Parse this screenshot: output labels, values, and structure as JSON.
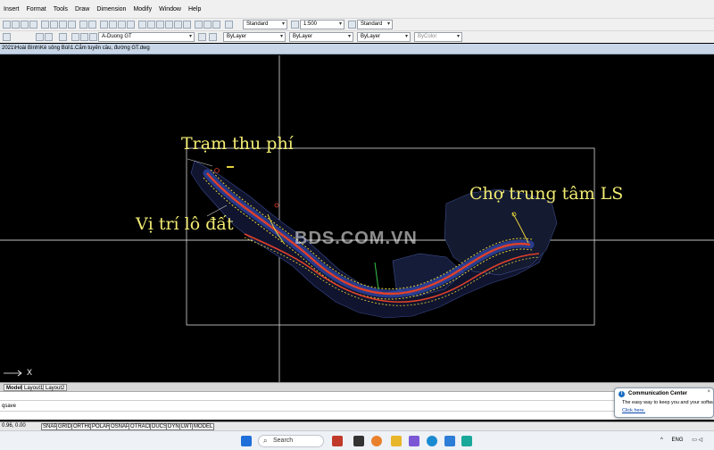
{
  "menu": [
    "Insert",
    "Format",
    "Tools",
    "Draw",
    "Dimension",
    "Modify",
    "Window",
    "Help"
  ],
  "toolbar": {
    "text_style": "Standard",
    "scale": "1:500",
    "dim_style": "Standard",
    "layer": "A-Duong GT",
    "color": "ByLayer",
    "linetype": "ByLayer",
    "lineweight": "ByLayer",
    "plotstyle": "ByColor"
  },
  "file_title": "2021\\Hoài Bình\\Kè sông Bùi\\1.Cắm tuyến cầu, đường GT.dwg",
  "annotations": {
    "toll": "Trạm thu phí",
    "lot": "Vị trí lô đất",
    "market": "Chợ trung tâm LS"
  },
  "watermark": "BDS.COM.VN",
  "ucs_x": "X",
  "tabs": [
    "Model",
    "Layout1",
    "Layout2"
  ],
  "command": {
    "text": "qsave"
  },
  "status": {
    "coords": "0.96, 0.00",
    "buttons": [
      "SNAP",
      "GRID",
      "ORTHO",
      "POLAR",
      "OSNAP",
      "OTRACK",
      "DUCS",
      "DYN",
      "LWT",
      "MODEL"
    ]
  },
  "notification": {
    "title": "Communication Center",
    "body": "The easy way to keep you and your software up",
    "link": "Click here."
  },
  "taskbar": {
    "search": "Search",
    "lang": "ENG"
  },
  "colors": {
    "annotation": "#f2ec73",
    "canvas": "#000000",
    "road_red": "#e0402a",
    "road_yellow": "#e6d23c",
    "road_blue": "#3b5bdb"
  }
}
